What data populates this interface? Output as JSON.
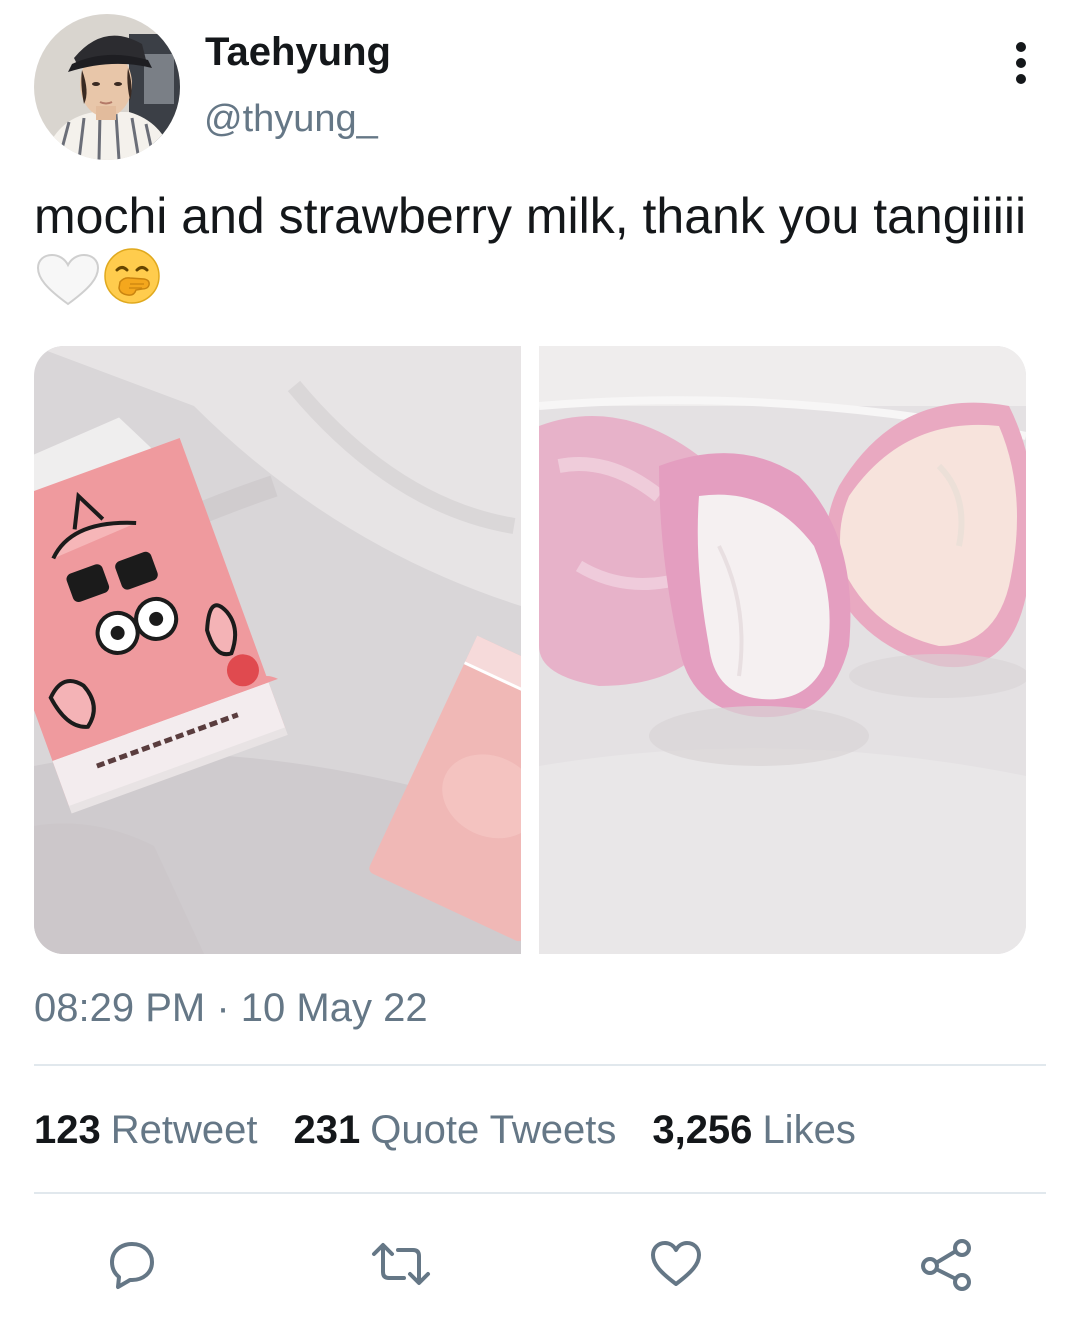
{
  "author": {
    "display_name": "Taehyung",
    "handle": "@thyung_",
    "avatar_icon": "profile-photo"
  },
  "tweet": {
    "text": "mochi and strawberry milk, thank you tangiiiii",
    "emojis": [
      "white-heart-icon",
      "face-with-hand-over-mouth-icon"
    ],
    "media": [
      {
        "description_icon": "strawberry-milk-carton-photo"
      },
      {
        "description_icon": "pink-mochi-photo"
      }
    ],
    "time": "08:29 PM",
    "separator": "·",
    "date": "10 May 22"
  },
  "stats": {
    "retweets": {
      "count": "123",
      "label": "Retweet"
    },
    "quotes": {
      "count": "231",
      "label": "Quote Tweets"
    },
    "likes": {
      "count": "3,256",
      "label": "Likes"
    }
  },
  "actions": [
    "reply-icon",
    "retweet-icon",
    "like-icon",
    "share-icon"
  ],
  "colors": {
    "text_primary": "#14171a",
    "text_secondary": "#657786",
    "icon": "#657786",
    "divider": "#e1e8ed"
  }
}
